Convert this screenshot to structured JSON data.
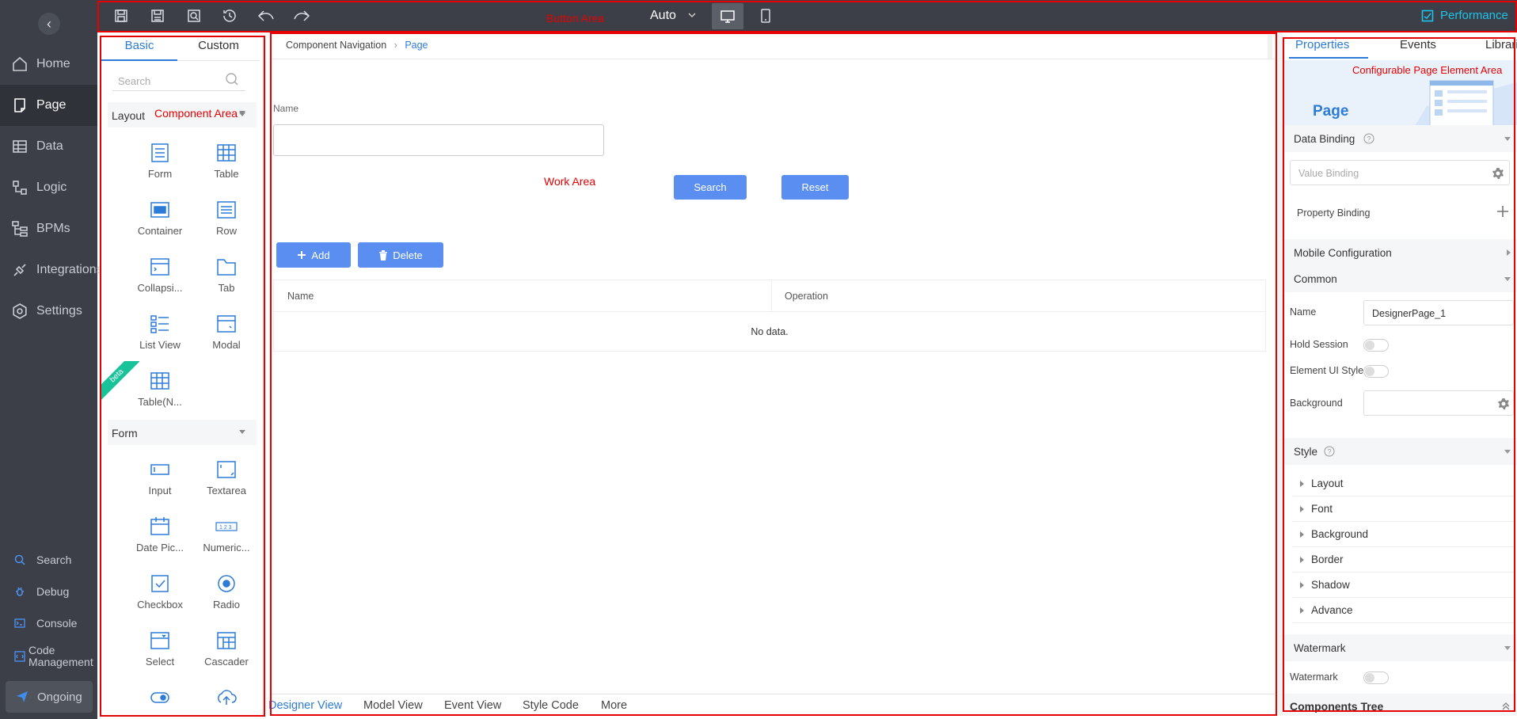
{
  "nav": {
    "items": [
      {
        "label": "Home",
        "icon": "home-icon"
      },
      {
        "label": "Page",
        "icon": "page-icon"
      },
      {
        "label": "Data",
        "icon": "table-icon"
      },
      {
        "label": "Logic",
        "icon": "logic-icon"
      },
      {
        "label": "BPMs",
        "icon": "bpm-icon"
      },
      {
        "label": "Integrations",
        "icon": "plug-icon"
      },
      {
        "label": "Settings",
        "icon": "gear-icon"
      }
    ],
    "bottom": [
      {
        "label": "Search",
        "icon": "search-icon"
      },
      {
        "label": "Debug",
        "icon": "debug-icon"
      },
      {
        "label": "Console",
        "icon": "console-icon"
      },
      {
        "label": "Code Management",
        "icon": "code-icon"
      }
    ],
    "ongoing": "Ongoing"
  },
  "topbar": {
    "auto": "Auto",
    "performance": "Performance",
    "annotation": "Button Area"
  },
  "left": {
    "tabs": [
      "Basic",
      "Custom"
    ],
    "search_placeholder": "Search",
    "annotation": "Component Area",
    "layout_group": "Layout",
    "layout_items": [
      "Form",
      "Table",
      "Container",
      "Row",
      "Collapsi...",
      "Tab",
      "List View",
      "Modal",
      "Table(N..."
    ],
    "beta": "beta",
    "form_group": "Form",
    "form_items": [
      "Input",
      "Textarea",
      "Date Pic...",
      "Numeric...",
      "Checkbox",
      "Radio",
      "Select",
      "Cascader"
    ]
  },
  "canvas": {
    "breadcrumb": [
      "Component Navigation",
      "Page"
    ],
    "name_label": "Name",
    "annotation": "Work Area",
    "search_btn": "Search",
    "reset_btn": "Reset",
    "add_btn": "Add",
    "delete_btn": "Delete",
    "table": {
      "columns": [
        "Name",
        "Operation"
      ],
      "empty": "No data."
    },
    "bottom_tabs": [
      "Designer View",
      "Model View",
      "Event View",
      "Style Code",
      "More"
    ]
  },
  "right": {
    "tabs": [
      "Properties",
      "Events",
      "Libraries"
    ],
    "banner_title": "Page",
    "annotation": "Configurable Page Element Area",
    "data_binding": "Data Binding",
    "value_binding_placeholder": "Value Binding",
    "property_binding": "Property Binding",
    "mobile_config": "Mobile Configuration",
    "common": "Common",
    "name_label": "Name",
    "name_value": "DesignerPage_1",
    "hold_session": "Hold Session",
    "element_ui_style": "Element UI Style",
    "background": "Background",
    "style": "Style",
    "style_items": [
      "Layout",
      "Font",
      "Background",
      "Border",
      "Shadow",
      "Advance"
    ],
    "watermark_section": "Watermark",
    "watermark_label": "Watermark",
    "components_tree": "Components Tree"
  },
  "colors": {
    "accent": "#2d7bd8",
    "annotation_red": "#e60000",
    "sidebar": "#3c3f47",
    "button_blue": "#5a8ef0",
    "performance": "#1ec3ea"
  }
}
